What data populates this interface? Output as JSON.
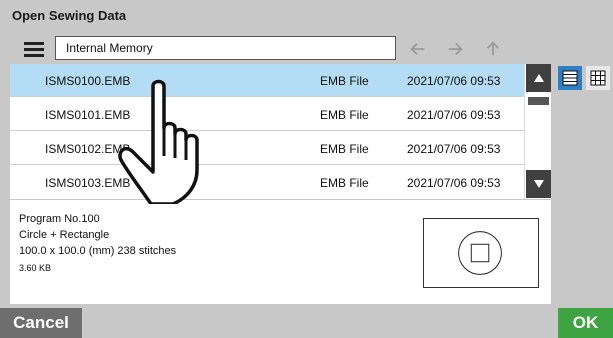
{
  "dialog": {
    "title": "Open Sewing Data"
  },
  "toolbar": {
    "menu_icon": "hamburger-menu-icon",
    "location": "Internal Memory",
    "nav": {
      "back_icon": "arrow-left-icon",
      "forward_icon": "arrow-right-icon",
      "up_icon": "arrow-up-icon"
    }
  },
  "files": [
    {
      "name": "ISMS0100.EMB",
      "type": "EMB File",
      "date": "2021/07/06 09:53",
      "selected": true
    },
    {
      "name": "ISMS0101.EMB",
      "type": "EMB File",
      "date": "2021/07/06 09:53",
      "selected": false
    },
    {
      "name": "ISMS0102.EMB",
      "type": "EMB File",
      "date": "2021/07/06 09:53",
      "selected": false
    },
    {
      "name": "ISMS0103.EMB",
      "type": "EMB File",
      "date": "2021/07/06 09:53",
      "selected": false
    }
  ],
  "scrollbar": {
    "up_icon": "triangle-up-icon",
    "down_icon": "triangle-down-icon"
  },
  "view_modes": {
    "list_icon": "list-view-icon",
    "grid_icon": "grid-view-icon",
    "active": "list"
  },
  "details": {
    "program": "Program No.100",
    "shape": "Circle + Rectangle",
    "dimensions": "100.0 x 100.0 (mm) 238 stitches",
    "size": "3.60 KB"
  },
  "buttons": {
    "cancel": "Cancel",
    "ok": "OK"
  },
  "colors": {
    "selection": "#b4dcf4",
    "ok_green": "#3ea341",
    "cancel_gray": "#6e6e6e",
    "active_view_blue": "#2f7fc4"
  }
}
